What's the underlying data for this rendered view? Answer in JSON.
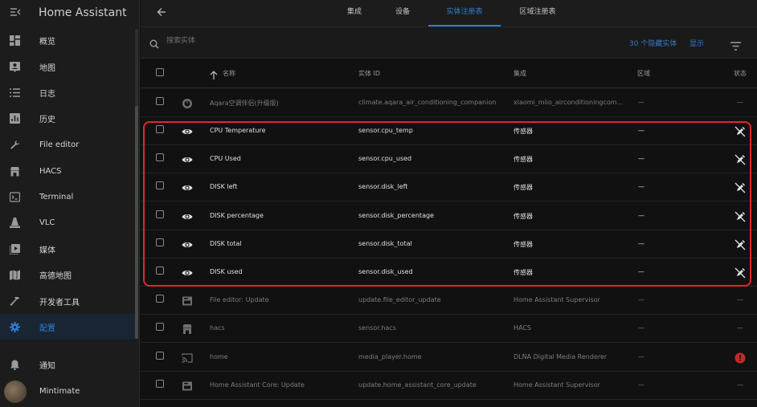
{
  "app": {
    "title": "Home Assistant"
  },
  "sidebar": {
    "items": [
      {
        "label": "概览",
        "icon": "dashboard-icon"
      },
      {
        "label": "地图",
        "icon": "map-account-icon"
      },
      {
        "label": "日志",
        "icon": "logbook-icon"
      },
      {
        "label": "历史",
        "icon": "history-chart-icon"
      },
      {
        "label": "File editor",
        "icon": "wrench-icon"
      },
      {
        "label": "HACS",
        "icon": "hacs-icon"
      },
      {
        "label": "Terminal",
        "icon": "terminal-icon"
      },
      {
        "label": "VLC",
        "icon": "vlc-cone-icon"
      },
      {
        "label": "媒体",
        "icon": "media-play-icon"
      },
      {
        "label": "高德地图",
        "icon": "map-icon"
      },
      {
        "label": "开发者工具",
        "icon": "hammer-icon"
      },
      {
        "label": "配置",
        "icon": "cog-icon",
        "active": true
      }
    ],
    "notifications": "通知",
    "user": "Mintimate"
  },
  "tabs": [
    {
      "label": "集成"
    },
    {
      "label": "设备"
    },
    {
      "label": "实体注册表",
      "active": true
    },
    {
      "label": "区域注册表"
    }
  ],
  "search": {
    "placeholder": "搜索实体",
    "hidden_count": "30 个隐藏实体",
    "show_label": "显示"
  },
  "table": {
    "headers": {
      "name": "名称",
      "entity_id": "实体 ID",
      "integration": "集成",
      "area": "区域",
      "status": "状态"
    },
    "rows": [
      {
        "name": "Aqara空调伴侣(升级版)",
        "entity_id": "climate.aqara_air_conditioning_companion",
        "integration": "xiaomi_miio_airconditioningcom...",
        "area": "—",
        "status": "—",
        "icon": "thermostat-icon",
        "disabled": true
      },
      {
        "name": "CPU Temperature",
        "entity_id": "sensor.cpu_temp",
        "integration": "传感器",
        "area": "—",
        "icon": "eye-icon",
        "status_icon": "pencil-off-icon"
      },
      {
        "name": "CPU Used",
        "entity_id": "sensor.cpu_used",
        "integration": "传感器",
        "area": "—",
        "icon": "eye-icon",
        "status_icon": "pencil-off-icon"
      },
      {
        "name": "DISK left",
        "entity_id": "sensor.disk_left",
        "integration": "传感器",
        "area": "—",
        "icon": "eye-icon",
        "status_icon": "pencil-off-icon"
      },
      {
        "name": "DISK percentage",
        "entity_id": "sensor.disk_percentage",
        "integration": "传感器",
        "area": "—",
        "icon": "eye-icon",
        "status_icon": "pencil-off-icon"
      },
      {
        "name": "DISK total",
        "entity_id": "sensor.disk_total",
        "integration": "传感器",
        "area": "—",
        "icon": "eye-icon",
        "status_icon": "pencil-off-icon"
      },
      {
        "name": "DISK used",
        "entity_id": "sensor.disk_used",
        "integration": "传感器",
        "area": "—",
        "icon": "eye-icon",
        "status_icon": "pencil-off-icon"
      },
      {
        "name": "File editor: Update",
        "entity_id": "update.file_editor_update",
        "integration": "Home Assistant Supervisor",
        "area": "—",
        "status": "—",
        "icon": "update-box-icon",
        "disabled": true
      },
      {
        "name": "hacs",
        "entity_id": "sensor.hacs",
        "integration": "HACS",
        "area": "—",
        "status": "—",
        "icon": "hacs-icon",
        "disabled": true
      },
      {
        "name": "home",
        "entity_id": "media_player.home",
        "integration": "DLNA Digital Media Renderer",
        "area": "—",
        "icon": "cast-icon",
        "status_icon": "alert-circle-icon",
        "disabled": true
      },
      {
        "name": "Home Assistant Core: Update",
        "entity_id": "update.home_assistant_core_update",
        "integration": "Home Assistant Supervisor",
        "area": "—",
        "status": "—",
        "icon": "update-box-icon",
        "disabled": true
      }
    ]
  },
  "colors": {
    "accent": "#2f7fd6",
    "highlight": "#e0262f",
    "alert": "#c62828"
  }
}
